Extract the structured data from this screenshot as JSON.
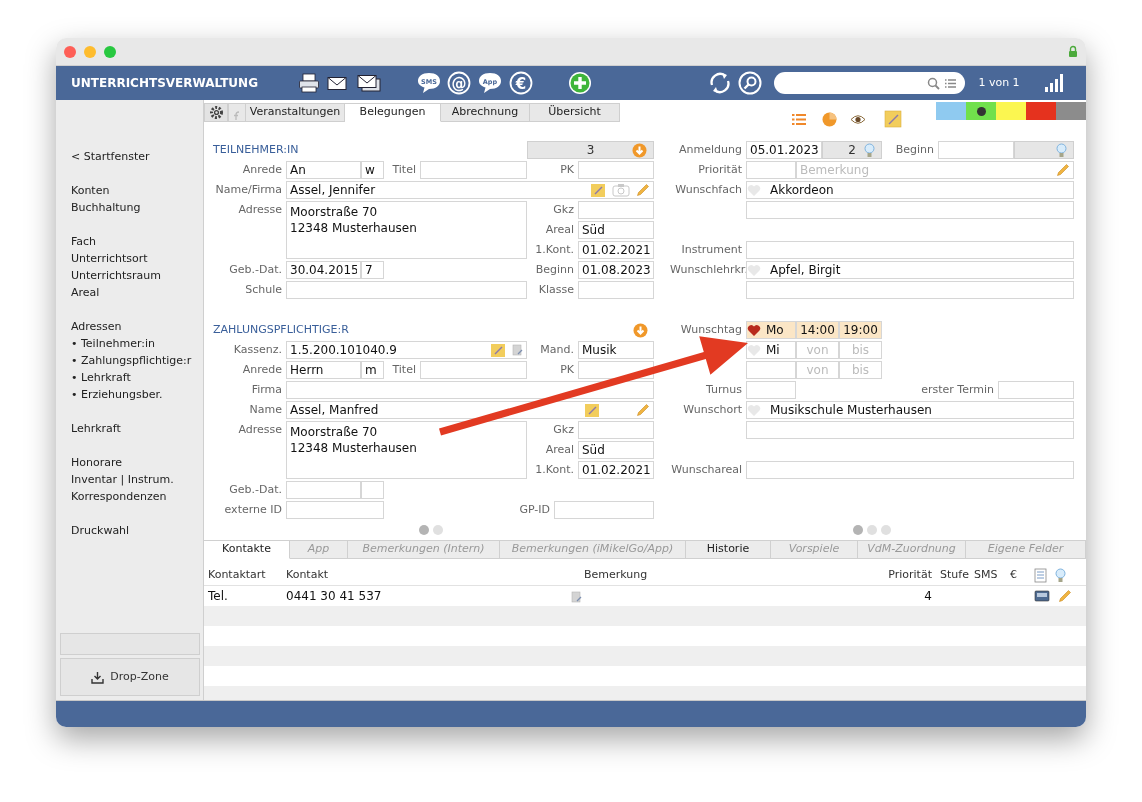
{
  "window": {
    "title": "UNTERRICHTSVERWALTUNG"
  },
  "toolbar": {
    "sms_label": "SMS",
    "at_symbol": "@",
    "app_label": "App",
    "euro_symbol": "€",
    "record_counter": "1 von 1"
  },
  "sidebar": {
    "groups": [
      {
        "items": [
          "< Startfenster"
        ]
      },
      {
        "items": [
          "Konten",
          "Buchhaltung"
        ]
      },
      {
        "items": [
          "Fach",
          "Unterrichtsort",
          "Unterrichtsraum",
          "Areal"
        ]
      },
      {
        "items": [
          "Adressen",
          "• Teilnehmer:in",
          "• Zahlungspflichtige:r",
          "• Lehrkraft",
          "• Erziehungsber."
        ]
      },
      {
        "items": [
          "Lehrkraft"
        ]
      },
      {
        "items": [
          "Honorare",
          "Inventar | Instrum.",
          "Korrespondenzen"
        ]
      },
      {
        "items": [
          "Druckwahl"
        ]
      }
    ],
    "dropzone": "Drop-Zone"
  },
  "tabs": [
    {
      "label": "Veranstaltungen",
      "selected": false
    },
    {
      "label": "Belegungen",
      "selected": true
    },
    {
      "label": "Abrechnung",
      "selected": false
    },
    {
      "label": "Übersicht",
      "selected": false
    }
  ],
  "color_swatches": [
    {
      "color": "#8fcaf0",
      "selected": false
    },
    {
      "color": "#71e04c",
      "selected": true
    },
    {
      "color": "#fbf650",
      "selected": false
    },
    {
      "color": "#e5321e",
      "selected": false
    },
    {
      "color": "#8c8c8c",
      "selected": false
    }
  ],
  "participant": {
    "heading": "TEILNEHMER:IN",
    "count": "3",
    "salutation": {
      "label": "Anrede",
      "value": "An"
    },
    "gender": {
      "value": "w"
    },
    "title": {
      "label": "Titel"
    },
    "pk": {
      "label": "PK"
    },
    "name": {
      "label": "Name/Firma",
      "value": "Assel, Jennifer"
    },
    "address": {
      "label": "Adresse",
      "value": "Moorstraße 70\n12348 Musterhausen"
    },
    "gkz": {
      "label": "Gkz"
    },
    "area": {
      "label": "Areal",
      "value": "Süd"
    },
    "first_contact": {
      "label": "1.Kont.",
      "value": "01.02.2021"
    },
    "birth_date": {
      "label": "Geb.-Dat.",
      "value": "30.04.2015"
    },
    "age": {
      "value": "7"
    },
    "start": {
      "label": "Beginn",
      "value": "01.08.2023"
    },
    "school": {
      "label": "Schule"
    },
    "class": {
      "label": "Klasse"
    }
  },
  "payer": {
    "heading": "ZAHLUNGSPFLICHTIGE:R",
    "cash_id": {
      "label": "Kassenz.",
      "value": "1.5.200.101040.9"
    },
    "client": {
      "label": "Mand.",
      "value": "Musik"
    },
    "salutation": {
      "label": "Anrede",
      "value": "Herrn"
    },
    "gender": {
      "value": "m"
    },
    "title": {
      "label": "Titel"
    },
    "pk": {
      "label": "PK"
    },
    "company": {
      "label": "Firma"
    },
    "name": {
      "label": "Name",
      "value": "Assel, Manfred"
    },
    "address": {
      "label": "Adresse",
      "value": "Moorstraße 70\n12348 Musterhausen"
    },
    "gkz": {
      "label": "Gkz"
    },
    "area": {
      "label": "Areal",
      "value": "Süd"
    },
    "first_contact": {
      "label": "1.Kont.",
      "value": "01.02.2021"
    },
    "birth_date": {
      "label": "Geb.-Dat."
    },
    "external_id": {
      "label": "externe ID"
    },
    "gp_id": {
      "label": "GP-ID"
    },
    "pager": [
      {
        "selected": true
      },
      {
        "selected": false
      }
    ]
  },
  "registration": {
    "registered": {
      "label": "Anmeldung",
      "value": "05.01.2023"
    },
    "rank": {
      "value": "2"
    },
    "start": {
      "label": "Beginn"
    },
    "priority": {
      "label": "Priorität"
    },
    "remark": {
      "placeholder": "Bemerkung"
    },
    "subject": {
      "label": "Wunschfach",
      "value": "Akkordeon",
      "favorite": false
    },
    "instrument": {
      "label": "Instrument"
    },
    "teacher": {
      "label": "Wunschlehrkr.",
      "value": "Apfel, Birgit",
      "favorite": false
    },
    "days": {
      "label": "Wunschtag",
      "entries": [
        {
          "day": "Mo",
          "from": "14:00",
          "to": "19:00",
          "favorite": true
        },
        {
          "day": "Mi",
          "from_placeholder": "von",
          "to_placeholder": "bis",
          "favorite": false
        },
        {
          "from_placeholder": "von",
          "to_placeholder": "bis"
        }
      ]
    },
    "interval": {
      "label": "Turnus"
    },
    "first_date": {
      "label": "erster Termin"
    },
    "location": {
      "label": "Wunschort",
      "value": "Musikschule Musterhausen",
      "favorite": false
    },
    "area": {
      "label": "Wunschareal"
    },
    "pager": [
      {
        "selected": true
      },
      {
        "selected": false
      },
      {
        "selected": false
      }
    ]
  },
  "bottom_tabs": [
    {
      "label": "Kontakte",
      "selected": true,
      "has_content": true
    },
    {
      "label": "App",
      "selected": false,
      "has_content": false
    },
    {
      "label": "Bemerkungen (Intern)",
      "selected": false,
      "has_content": false
    },
    {
      "label": "Bemerkungen (iMikelGo/App)",
      "selected": false,
      "has_content": false
    },
    {
      "label": "Historie",
      "selected": false,
      "has_content": true
    },
    {
      "label": "Vorspiele",
      "selected": false,
      "has_content": false
    },
    {
      "label": "VdM-Zuordnung",
      "selected": false,
      "has_content": false
    },
    {
      "label": "Eigene Felder",
      "selected": false,
      "has_content": false
    }
  ],
  "contacts": {
    "columns": [
      "Kontaktart",
      "Kontakt",
      "Bemerkung",
      "Priorität",
      "Stufe",
      "SMS",
      "€"
    ],
    "rows": [
      {
        "type": "Tel.",
        "contact": "0441 30 41 537",
        "priority": "4"
      }
    ]
  }
}
